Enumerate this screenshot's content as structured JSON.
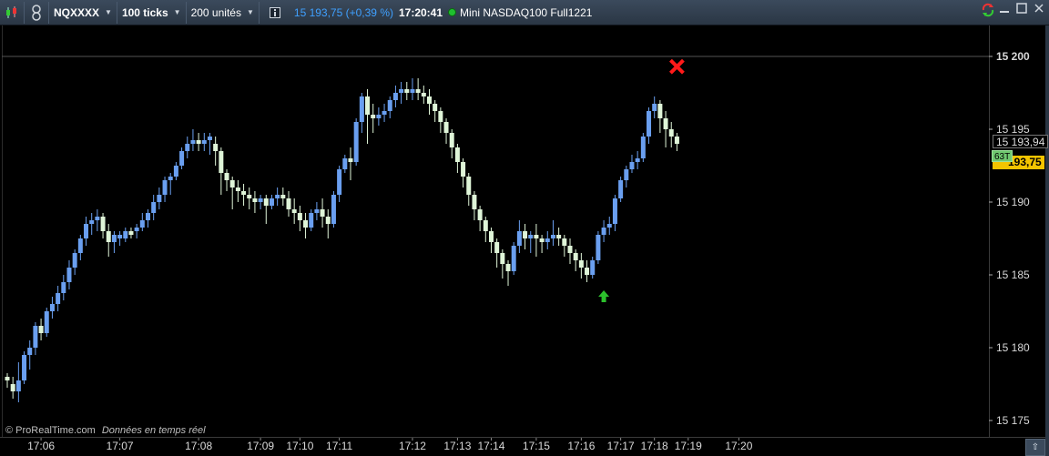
{
  "toolbar": {
    "symbol": "NQXXXX",
    "period": "100 ticks",
    "units": "200 unités",
    "last_price": "15 193,75",
    "change_pct": "(+0,39 %)",
    "time": "17:20:41",
    "instrument": "Mini NASDAQ100 Full1221",
    "icons": [
      "candlestick-chart-icon",
      "link-icon",
      "info-icon",
      "sync-icon",
      "minimize-icon",
      "maximize-icon",
      "close-icon"
    ]
  },
  "price_axis": {
    "ticks": [
      "15 200",
      "15 195",
      "15 190",
      "15 185",
      "15 180",
      "15 175"
    ],
    "last_tag": "15 193,94",
    "current_tag": "193,75",
    "tick_count_tag": "63T"
  },
  "time_axis": {
    "labels": [
      "17:06",
      "17:07",
      "17:08",
      "17:09",
      "17:10",
      "17:11",
      "17:12",
      "17:13",
      "17:14",
      "17:15",
      "17:16",
      "17:17",
      "17:18",
      "17:19",
      "17:20"
    ]
  },
  "watermark": {
    "site": "© ProRealTime.com",
    "tagline": "Données en temps réel"
  },
  "colors": {
    "up": "#6a9ff0",
    "down": "#dff5d8",
    "buy_arrow": "#2cc02c",
    "sell_cross": "#ff1a1a",
    "background": "#000000"
  },
  "chart_data": {
    "type": "candlestick",
    "title": "",
    "ylim": [
      15174,
      15202
    ],
    "hline": 15200,
    "times": [
      "17:06",
      "17:07",
      "17:08",
      "17:09",
      "17:10",
      "17:11",
      "17:12",
      "17:13",
      "17:14",
      "17:15",
      "17:16",
      "17:17",
      "17:18",
      "17:19",
      "17:20"
    ],
    "candles": [
      [
        15178.0,
        15178.25,
        15177.75,
        15177.25
      ],
      [
        15177.5,
        15178.0,
        15177.0,
        15176.5
      ],
      [
        15177.0,
        15179.0,
        15177.75,
        15176.25
      ],
      [
        15177.75,
        15179.75,
        15179.5,
        15177.5
      ],
      [
        15179.5,
        15180.5,
        15180.0,
        15178.5
      ],
      [
        15180.0,
        15181.75,
        15181.5,
        15179.5
      ],
      [
        15181.5,
        15182.0,
        15181.0,
        15180.5
      ],
      [
        15181.0,
        15182.75,
        15182.5,
        15180.75
      ],
      [
        15182.5,
        15183.5,
        15183.0,
        15182.0
      ],
      [
        15183.0,
        15184.25,
        15183.75,
        15182.5
      ],
      [
        15183.75,
        15185.0,
        15184.5,
        15183.25
      ],
      [
        15184.5,
        15186.0,
        15185.5,
        15184.0
      ],
      [
        15185.5,
        15186.75,
        15186.5,
        15185.0
      ],
      [
        15186.5,
        15187.75,
        15187.5,
        15186.0
      ],
      [
        15187.5,
        15189.0,
        15188.5,
        15187.0
      ],
      [
        15188.5,
        15189.25,
        15188.75,
        15187.75
      ],
      [
        15188.75,
        15189.5,
        15189.0,
        15188.0
      ],
      [
        15189.0,
        15189.25,
        15188.0,
        15187.5
      ],
      [
        15188.0,
        15188.5,
        15187.25,
        15186.25
      ],
      [
        15187.25,
        15188.0,
        15187.75,
        15186.5
      ],
      [
        15187.5,
        15188.0,
        15187.75,
        15187.0
      ],
      [
        15187.5,
        15188.25,
        15188.0,
        15187.25
      ],
      [
        15188.0,
        15188.25,
        15187.75,
        15187.5
      ],
      [
        15188.0,
        15188.5,
        15188.25,
        15187.5
      ],
      [
        15188.25,
        15189.25,
        15188.75,
        15188.0
      ],
      [
        15188.75,
        15189.5,
        15189.25,
        15188.25
      ],
      [
        15189.25,
        15190.5,
        15190.0,
        15188.75
      ],
      [
        15190.0,
        15191.0,
        15190.5,
        15189.5
      ],
      [
        15190.5,
        15191.75,
        15191.5,
        15190.0
      ],
      [
        15191.5,
        15192.0,
        15191.75,
        15190.5
      ],
      [
        15191.75,
        15192.75,
        15192.5,
        15191.5
      ],
      [
        15192.5,
        15193.75,
        15193.5,
        15192.25
      ],
      [
        15193.5,
        15194.5,
        15194.0,
        15193.0
      ],
      [
        15194.0,
        15195.0,
        15194.25,
        15193.5
      ],
      [
        15194.25,
        15194.75,
        15194.0,
        15193.5
      ],
      [
        15194.0,
        15194.75,
        15194.25,
        15193.5
      ],
      [
        15194.25,
        15194.75,
        15194.5,
        15193.25
      ],
      [
        15194.0,
        15194.5,
        15193.5,
        15192.5
      ],
      [
        15193.5,
        15193.75,
        15192.0,
        15190.5
      ],
      [
        15192.0,
        15192.25,
        15191.5,
        15190.75
      ],
      [
        15191.5,
        15191.75,
        15191.0,
        15189.5
      ],
      [
        15191.0,
        15191.5,
        15190.75,
        15190.0
      ],
      [
        15190.75,
        15191.25,
        15190.5,
        15189.75
      ],
      [
        15190.5,
        15191.0,
        15190.25,
        15189.5
      ],
      [
        15190.25,
        15190.75,
        15190.0,
        15189.25
      ],
      [
        15190.0,
        15190.5,
        15190.25,
        15189.5
      ],
      [
        15190.25,
        15190.5,
        15189.75,
        15188.5
      ],
      [
        15189.75,
        15190.5,
        15190.25,
        15189.5
      ],
      [
        15190.25,
        15191.0,
        15190.5,
        15189.75
      ],
      [
        15190.5,
        15191.0,
        15190.25,
        15189.75
      ],
      [
        15190.25,
        15190.75,
        15189.5,
        15189.0
      ],
      [
        15189.5,
        15190.25,
        15189.25,
        15188.5
      ],
      [
        15189.25,
        15189.75,
        15188.75,
        15188.0
      ],
      [
        15188.75,
        15189.25,
        15188.25,
        15187.5
      ],
      [
        15188.25,
        15189.5,
        15189.25,
        15188.0
      ],
      [
        15189.25,
        15190.0,
        15189.5,
        15188.75
      ],
      [
        15189.5,
        15190.25,
        15189.0,
        15188.25
      ],
      [
        15189.0,
        15189.5,
        15188.5,
        15187.5
      ],
      [
        15188.5,
        15190.75,
        15190.5,
        15188.25
      ],
      [
        15190.5,
        15192.5,
        15192.25,
        15190.0
      ],
      [
        15192.25,
        15193.25,
        15193.0,
        15192.0
      ],
      [
        15193.0,
        15193.75,
        15192.75,
        15191.5
      ],
      [
        15192.75,
        15195.75,
        15195.5,
        15192.5
      ],
      [
        15195.5,
        15197.5,
        15197.25,
        15194.75
      ],
      [
        15197.25,
        15197.75,
        15196.0,
        15194.0
      ],
      [
        15196.0,
        15196.75,
        15195.75,
        15194.75
      ],
      [
        15195.75,
        15196.5,
        15196.0,
        15195.25
      ],
      [
        15196.0,
        15196.75,
        15196.25,
        15195.5
      ],
      [
        15196.25,
        15197.25,
        15197.0,
        15195.75
      ],
      [
        15197.0,
        15198.0,
        15197.5,
        15196.5
      ],
      [
        15197.5,
        15198.25,
        15197.75,
        15196.75
      ],
      [
        15197.75,
        15198.25,
        15197.5,
        15197.0
      ],
      [
        15197.5,
        15198.5,
        15197.75,
        15197.0
      ],
      [
        15197.75,
        15198.5,
        15197.5,
        15197.0
      ],
      [
        15197.5,
        15198.0,
        15197.25,
        15196.75
      ],
      [
        15197.25,
        15197.75,
        15196.75,
        15196.0
      ],
      [
        15196.75,
        15197.0,
        15196.25,
        15195.5
      ],
      [
        15196.25,
        15196.5,
        15195.5,
        15194.75
      ],
      [
        15195.5,
        15195.75,
        15194.75,
        15194.0
      ],
      [
        15194.75,
        15195.0,
        15193.75,
        15193.0
      ],
      [
        15193.75,
        15194.0,
        15192.75,
        15192.0
      ],
      [
        15192.75,
        15193.0,
        15191.75,
        15191.0
      ],
      [
        15191.75,
        15192.0,
        15190.5,
        15189.75
      ],
      [
        15190.5,
        15190.75,
        15189.5,
        15188.75
      ],
      [
        15189.5,
        15189.75,
        15188.75,
        15188.0
      ],
      [
        15188.75,
        15189.0,
        15188.0,
        15187.25
      ],
      [
        15188.0,
        15188.25,
        15187.25,
        15186.5
      ],
      [
        15187.25,
        15187.5,
        15186.5,
        15185.5
      ],
      [
        15186.5,
        15186.75,
        15185.75,
        15184.75
      ],
      [
        15185.75,
        15186.0,
        15185.25,
        15184.25
      ],
      [
        15185.25,
        15187.25,
        15187.0,
        15185.0
      ],
      [
        15187.0,
        15188.75,
        15188.0,
        15186.5
      ],
      [
        15188.0,
        15188.5,
        15187.5,
        15186.75
      ],
      [
        15187.5,
        15188.0,
        15187.75,
        15186.5
      ],
      [
        15187.75,
        15188.5,
        15187.5,
        15186.25
      ],
      [
        15187.5,
        15187.75,
        15187.25,
        15186.5
      ],
      [
        15187.25,
        15188.0,
        15187.5,
        15186.75
      ],
      [
        15187.5,
        15188.75,
        15187.75,
        15187.0
      ],
      [
        15187.75,
        15188.25,
        15187.5,
        15187.0
      ],
      [
        15187.5,
        15187.75,
        15187.0,
        15186.25
      ],
      [
        15187.0,
        15187.5,
        15186.5,
        15185.75
      ],
      [
        15186.5,
        15186.75,
        15186.0,
        15185.25
      ],
      [
        15186.0,
        15186.5,
        15185.5,
        15184.75
      ],
      [
        15185.5,
        15186.0,
        15185.0,
        15184.5
      ],
      [
        15185.0,
        15186.25,
        15186.0,
        15184.75
      ],
      [
        15186.0,
        15188.0,
        15187.75,
        15185.75
      ],
      [
        15187.75,
        15188.75,
        15188.25,
        15187.25
      ],
      [
        15188.25,
        15189.0,
        15188.5,
        15187.75
      ],
      [
        15188.5,
        15190.5,
        15190.25,
        15188.0
      ],
      [
        15190.25,
        15191.75,
        15191.5,
        15190.0
      ],
      [
        15191.5,
        15192.5,
        15192.25,
        15191.0
      ],
      [
        15192.25,
        15193.25,
        15192.75,
        15192.0
      ],
      [
        15192.75,
        15193.5,
        15193.0,
        15192.25
      ],
      [
        15193.0,
        15194.75,
        15194.5,
        15192.75
      ],
      [
        15194.5,
        15196.5,
        15196.25,
        15194.0
      ],
      [
        15196.25,
        15197.25,
        15196.75,
        15195.75
      ],
      [
        15196.75,
        15197.0,
        15195.75,
        15194.75
      ],
      [
        15195.75,
        15196.25,
        15195.0,
        15193.75
      ],
      [
        15195.0,
        15195.5,
        15194.5,
        15193.75
      ],
      [
        15194.5,
        15194.75,
        15194.0,
        15193.5
      ]
    ],
    "markers": [
      {
        "type": "buy-arrow",
        "index": 106,
        "price": 15183.5
      },
      {
        "type": "sell-cross",
        "index": 119,
        "price": 15199.3
      }
    ]
  }
}
